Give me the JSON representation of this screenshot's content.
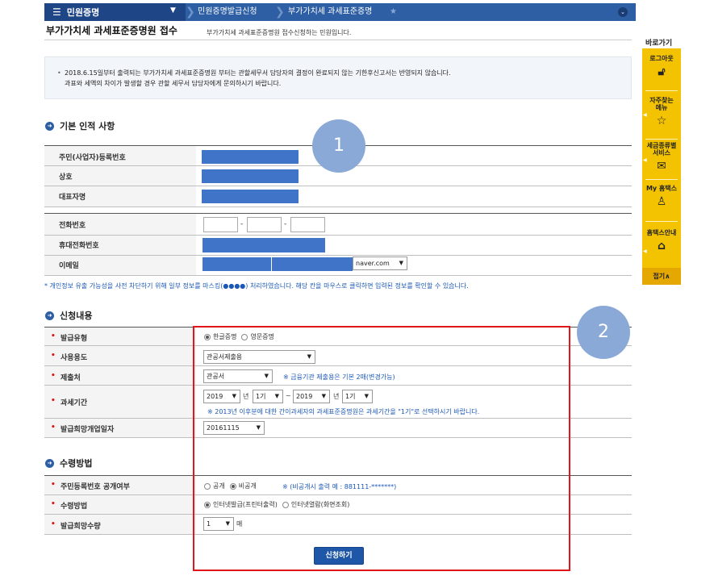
{
  "nav": {
    "menu_label": "민원증명",
    "crumb1": "민원증명발급신청",
    "crumb2": "부가가치세 과세표준증명",
    "star": "★",
    "expand": "⌄"
  },
  "title": {
    "main": "부가가치세 과세표준증명원 접수",
    "sub": "부가가치세 과세표준증명원 접수신청하는 민원입니다."
  },
  "notice": {
    "line1": "2018.6.15일부터 출력되는 부가가치세 과세표준증명원 부터는 관할세무서 담당자의 결정이 완료되지 않는 기한후신고서는 반영되지 않습니다.",
    "line2": "과표와 세액의 차이가 발생할 경우 관할 세무서 담당자에게 문의하시기 바랍니다."
  },
  "basic": {
    "heading": "기본 인적 사항",
    "reg_no_label": "주민(사업자)등록번호",
    "trade_name_label": "상호",
    "rep_label": "대표자명",
    "phone_label": "전화번호",
    "mobile_label": "휴대전화번호",
    "email_label": "이메일",
    "email_domain": "naver.com",
    "dash": "-"
  },
  "privacy_note": "* 개인정보 유출 가능성을 사전 차단하기 위해 일부 정보를 마스킹(●●●●) 처리하였습니다. 해당 칸을 마우스로 클릭하면 입력된 정보를 확인할 수 있습니다.",
  "application": {
    "heading": "신청내용",
    "issue_type_label": "발급유형",
    "issue_korean": "한글증명",
    "issue_english": "영문증명",
    "purpose_label": "사용용도",
    "purpose_value": "관공서제출용",
    "submit_to_label": "제출처",
    "submit_to_value": "관공서",
    "submit_to_note": "※ 금융기관 제출용은 기본 2매(변경가능)",
    "period_label": "과세기간",
    "from_year": "2019",
    "from_term": "1기",
    "to_year": "2019",
    "to_term": "1기",
    "year_word": "년",
    "tilde": "~",
    "period_note": "※ 2013년 이후분에 대한 간이과세자의 과세표준증명원은 과세기간을 \"1기\"로 선택하시기 바랍니다.",
    "open_date_label": "발급희망개업일자",
    "open_date_value": "20161115"
  },
  "receive": {
    "heading": "수령방법",
    "disclose_label": "주민등록번호 공개여부",
    "disclose_public": "공개",
    "disclose_private": "비공개",
    "disclose_note": "※ (비공개시 출력 예 : 881111-*******)",
    "method_label": "수령방법",
    "method_print": "인터넷발급(프린터출력)",
    "method_view": "인터넷열람(화면조회)",
    "qty_label": "발급희망수량",
    "qty_value": "1",
    "qty_unit": "매"
  },
  "submit_label": "신청하기",
  "markers": {
    "m1": "1",
    "m2": "2"
  },
  "quick": {
    "title": "바로가기",
    "logout": "로그아웃",
    "faq": "자주찾는 메뉴",
    "tax_service": "세금종류별 서비스",
    "my_hometax": "My 홈택스",
    "guide": "홈택스안내",
    "close": "접기∧"
  },
  "colors": {
    "nav": "#2e5fa5",
    "quickbar": "#f3c200",
    "highlight": "#e2151b",
    "redaction": "#3f74c9"
  }
}
